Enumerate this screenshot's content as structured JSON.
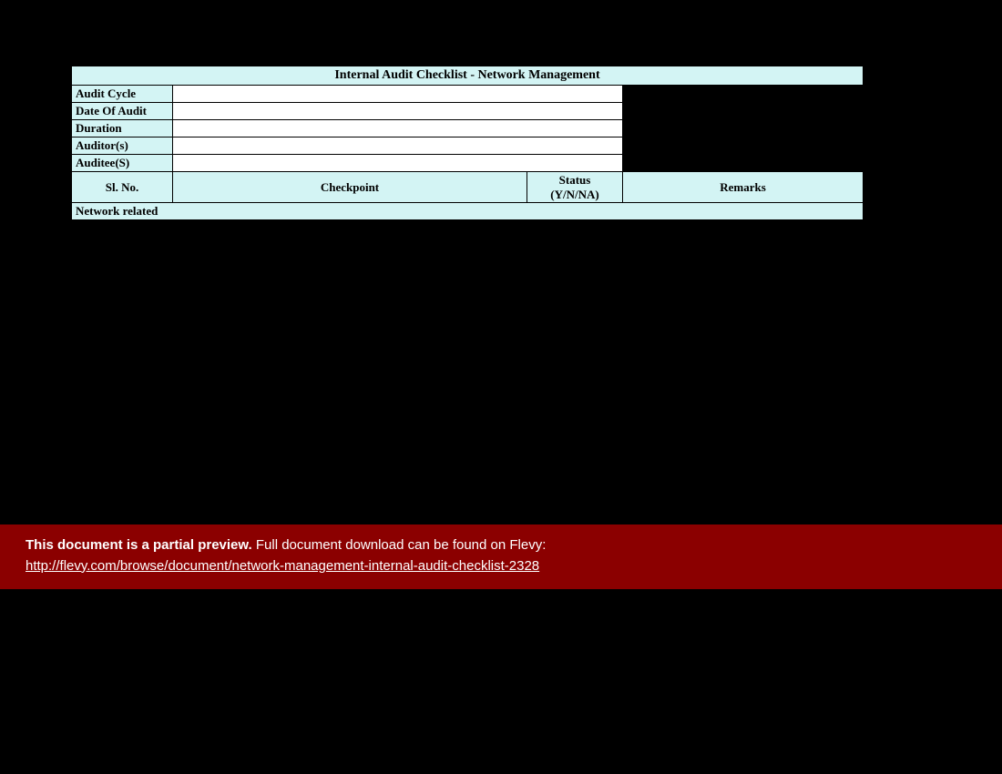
{
  "sheet": {
    "title": "Internal Audit Checklist - Network Management",
    "meta": [
      {
        "label": "Audit Cycle",
        "value": ""
      },
      {
        "label": "Date Of Audit",
        "value": ""
      },
      {
        "label": "Duration",
        "value": ""
      },
      {
        "label": "Auditor(s)",
        "value": ""
      },
      {
        "label": "Auditee(S)",
        "value": ""
      }
    ],
    "headers": {
      "slno": "Sl. No.",
      "checkpoint": "Checkpoint",
      "status_line1": "Status",
      "status_line2": "(Y/N/NA)",
      "remarks": "Remarks"
    },
    "section": "Network related"
  },
  "banner": {
    "bold_text": "This document is a partial preview.",
    "rest_text": "  Full document download can be found on Flevy:",
    "link_text": "http://flevy.com/browse/document/network-management-internal-audit-checklist-2328"
  }
}
